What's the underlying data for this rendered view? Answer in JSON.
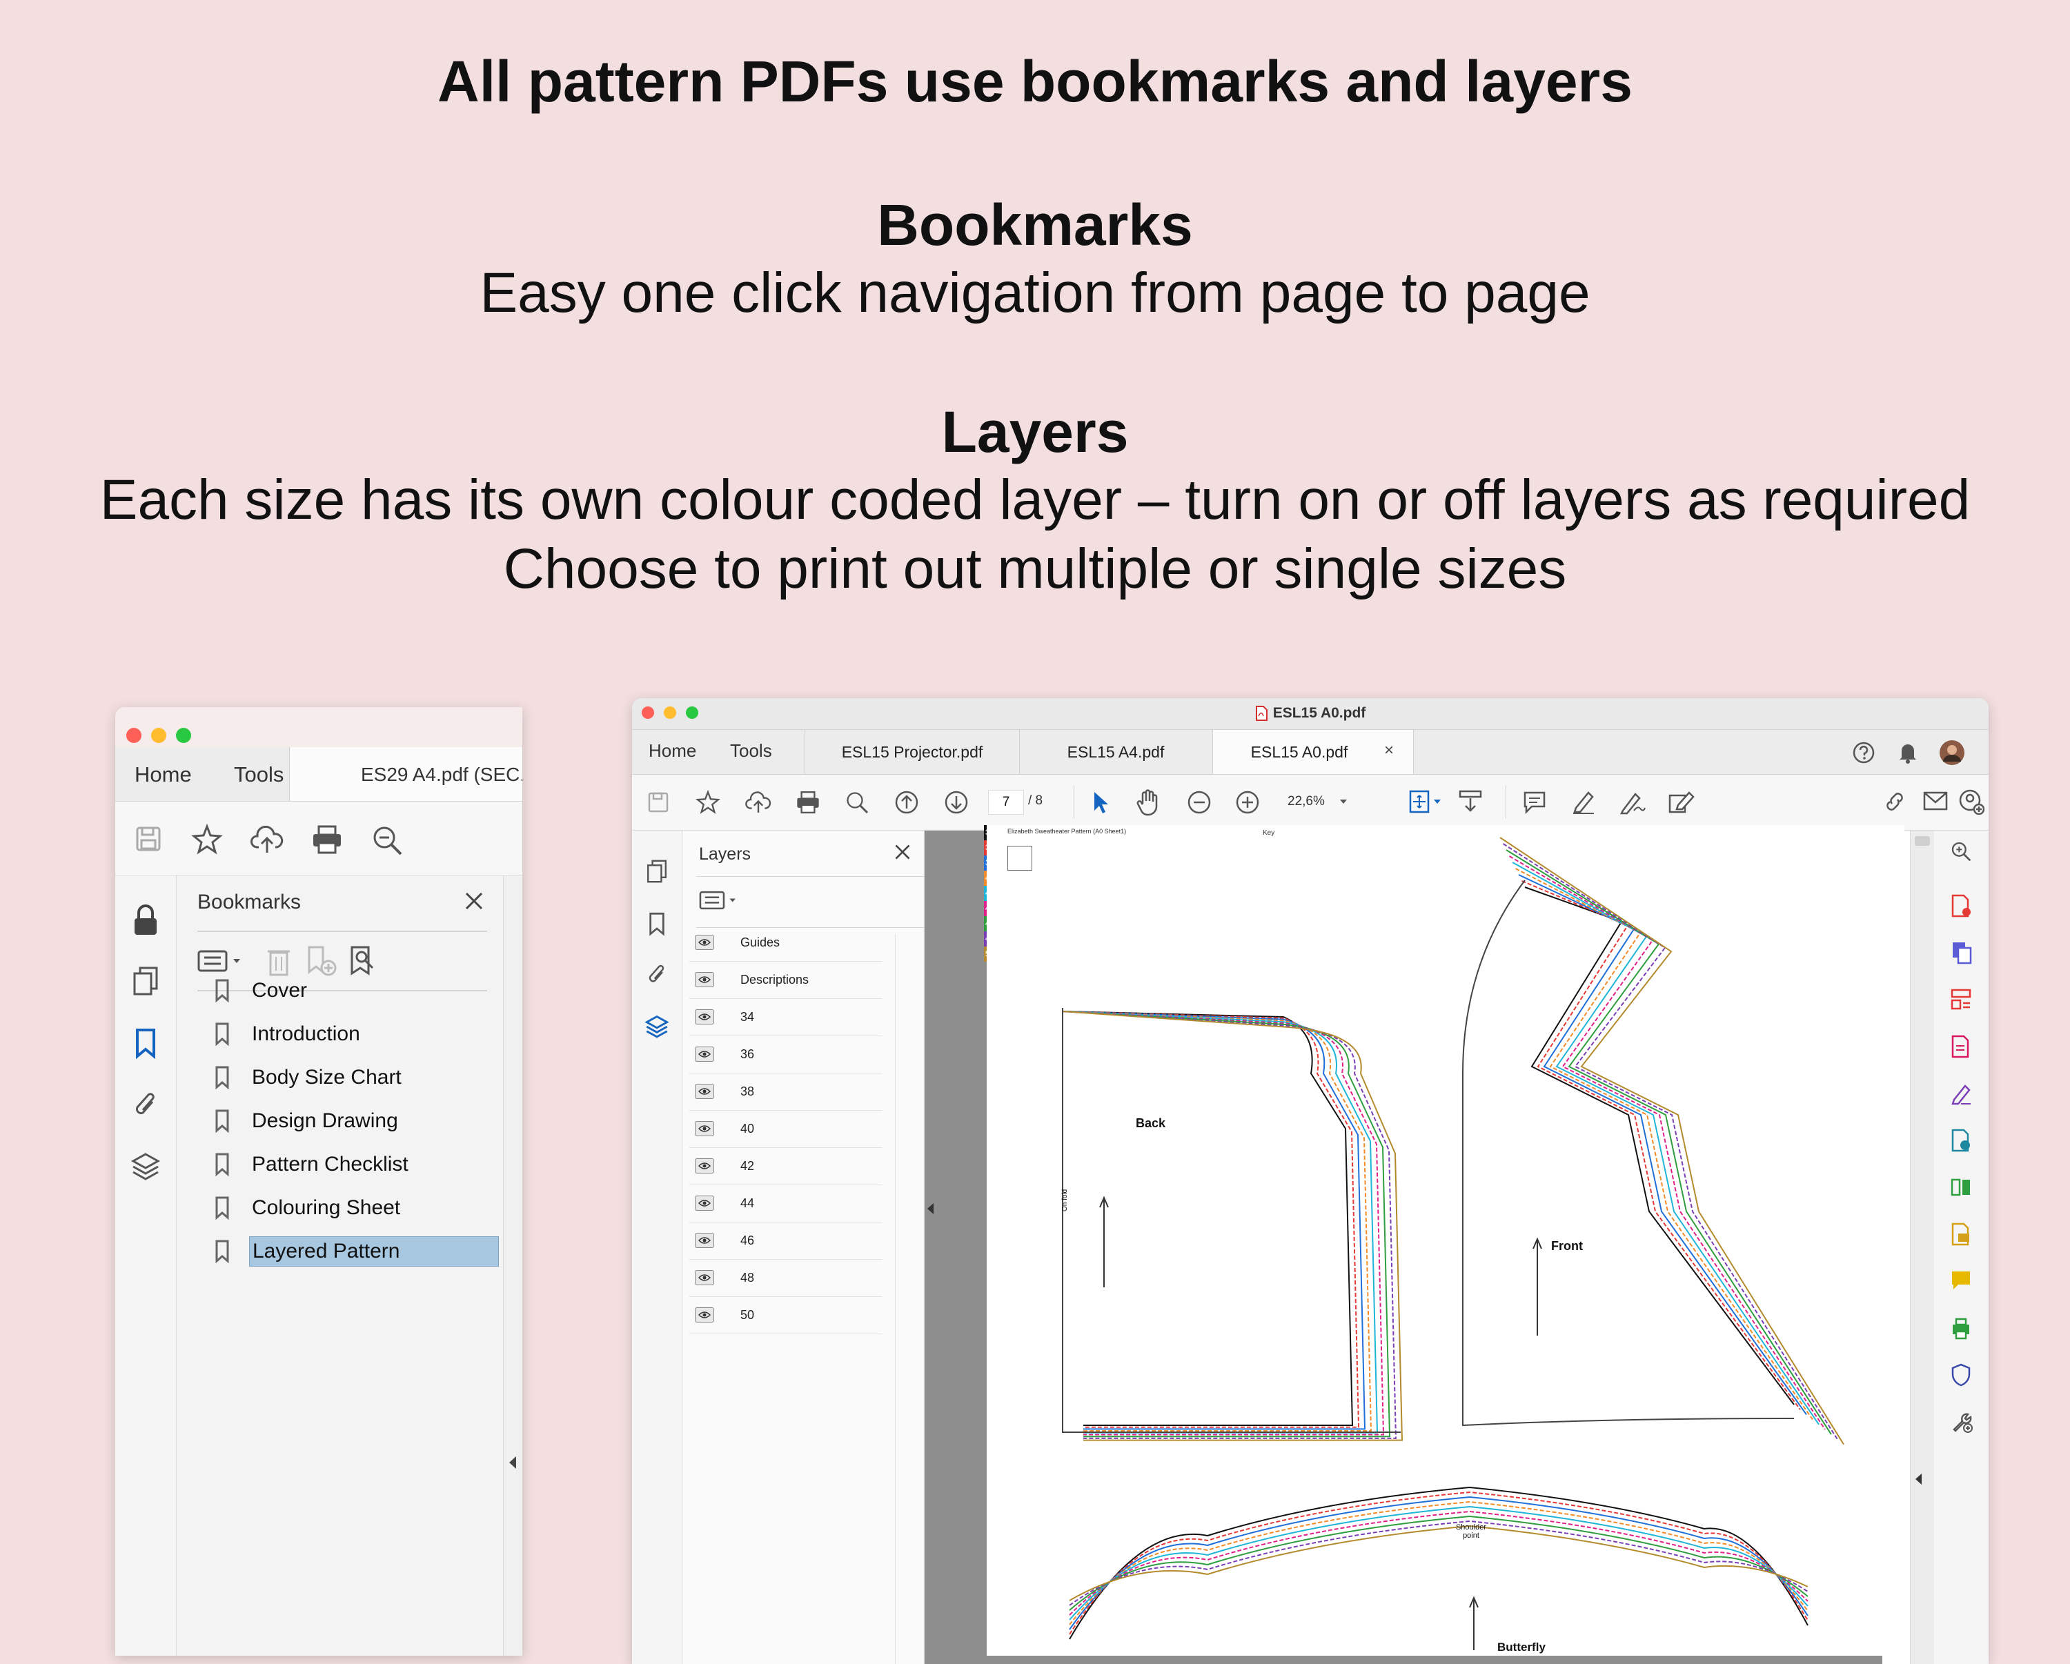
{
  "headings": {
    "main": "All pattern PDFs use bookmarks and layers",
    "bookmarks_title": "Bookmarks",
    "bookmarks_desc": "Easy one click navigation from page to page",
    "layers_title": "Layers",
    "layers_desc_1": "Each size has its own colour coded layer – turn on or off layers as required",
    "layers_desc_2": "Choose to print out multiple or single sizes"
  },
  "window1": {
    "tabs": {
      "home": "Home",
      "tools": "Tools",
      "document": "ES29 A4.pdf (SEC."
    },
    "panel_title": "Bookmarks",
    "bookmarks": [
      {
        "label": "Cover",
        "selected": false
      },
      {
        "label": "Introduction",
        "selected": false
      },
      {
        "label": "Body Size Chart",
        "selected": false
      },
      {
        "label": "Design Drawing",
        "selected": false
      },
      {
        "label": "Pattern Checklist",
        "selected": false
      },
      {
        "label": "Colouring Sheet",
        "selected": false
      },
      {
        "label": "Layered Pattern",
        "selected": true
      }
    ]
  },
  "window2": {
    "title": "ESL15 A0.pdf",
    "tabs": {
      "home": "Home",
      "tools": "Tools"
    },
    "doc_tabs": [
      "ESL15 Projector.pdf",
      "ESL15 A4.pdf",
      "ESL15 A0.pdf"
    ],
    "close_tab": "×",
    "page_current": "7",
    "page_total": "/ 8",
    "zoom": "22,6%",
    "panel_title": "Layers",
    "layers": [
      "Guides",
      "Descriptions",
      "34",
      "36",
      "38",
      "40",
      "42",
      "44",
      "46",
      "48",
      "50"
    ],
    "size_key": [
      {
        "label": "34",
        "color": "#111111"
      },
      {
        "label": "36",
        "color": "#e53935"
      },
      {
        "label": "38",
        "color": "#1e6fd9"
      },
      {
        "label": "40",
        "color": "#f28c28"
      },
      {
        "label": "42",
        "color": "#1fb5d8"
      },
      {
        "label": "44",
        "color": "#e0218a"
      },
      {
        "label": "46",
        "color": "#2e9e3e"
      },
      {
        "label": "48",
        "color": "#7b3fb5"
      },
      {
        "label": "50",
        "color": "#b38b2d"
      }
    ],
    "page_text": {
      "sheet_title": "Elizabeth Sweatheater Pattern (A0 Sheet1)",
      "key": "Key",
      "back": "Back",
      "front": "Front",
      "shoulder": "Shoulder point",
      "butterfly": "Butterfly",
      "on_fold": "On fold"
    }
  },
  "colors": {
    "background": "#f3dfe0",
    "selection": "#a7c7e0",
    "accent_blue": "#1565c0"
  }
}
